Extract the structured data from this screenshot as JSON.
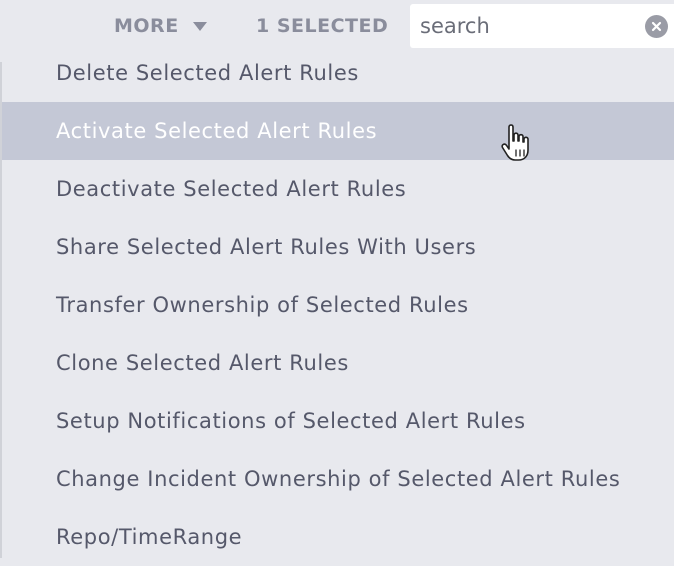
{
  "toolbar": {
    "more_label": "MORE",
    "selected_label": "1 SELECTED"
  },
  "search": {
    "value": "",
    "placeholder": "search",
    "clear_icon": "clear-circle-icon"
  },
  "menu": {
    "hovered_index": 1,
    "items": [
      {
        "label": "Delete Selected Alert Rules"
      },
      {
        "label": "Activate Selected Alert Rules"
      },
      {
        "label": "Deactivate Selected Alert Rules"
      },
      {
        "label": "Share Selected Alert Rules With Users"
      },
      {
        "label": "Transfer Ownership of Selected Rules"
      },
      {
        "label": "Clone Selected Alert Rules"
      },
      {
        "label": "Setup Notifications of Selected Alert Rules"
      },
      {
        "label": "Change Incident Ownership of Selected Alert Rules"
      },
      {
        "label": "Repo/TimeRange"
      }
    ]
  },
  "colors": {
    "background": "#e8e9ee",
    "hover_background": "#c4c8d6",
    "text": "#55586a",
    "header_text": "#8a8d9c"
  }
}
